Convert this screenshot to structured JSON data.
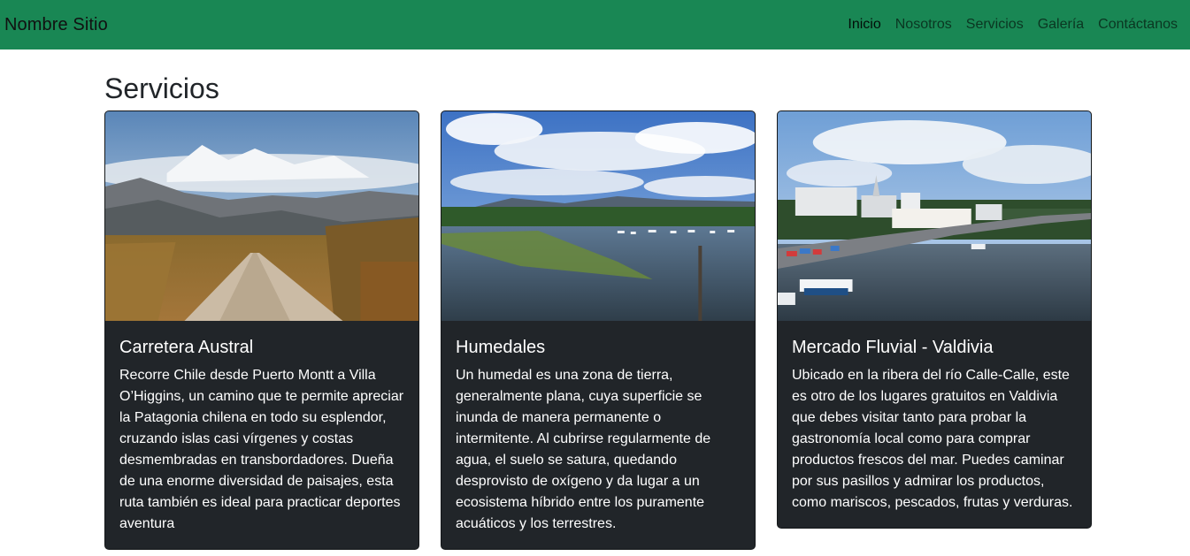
{
  "navbar": {
    "brand": "Nombre Sitio",
    "links": [
      {
        "label": "Inicio",
        "active": true
      },
      {
        "label": "Nosotros",
        "active": false
      },
      {
        "label": "Servicios",
        "active": false
      },
      {
        "label": "Galería",
        "active": false
      },
      {
        "label": "Contáctanos",
        "active": false
      }
    ]
  },
  "page": {
    "title": "Servicios"
  },
  "cards": [
    {
      "title": "Carretera Austral",
      "text": "Recorre Chile desde Puerto Montt a Villa O’Higgins, un camino que te permite apreciar la Patagonia chilena en todo su esplendor, cruzando islas casi vírgenes y costas desmembradas en transbordadores. Dueña de una enorme diversidad de paisajes, esta ruta también es ideal para practicar deportes aventura"
    },
    {
      "title": "Humedales",
      "text": "Un humedal es una zona de tierra, generalmente plana, cuya superficie se inunda de manera permanente o intermitente. Al cubrirse regularmente de agua, el suelo se satura, quedando desprovisto de oxígeno y da lugar a un ecosistema híbrido entre los puramente acuáticos y los terrestres."
    },
    {
      "title": "Mercado Fluvial - Valdivia",
      "text": "Ubicado en la ribera del río Calle-Calle, este es otro de los lugares gratuitos en Valdivia que debes visitar tanto para probar la gastronomía local como para comprar productos frescos del mar. Puedes caminar por sus pasillos y admirar los productos, como mariscos, pescados, frutas y verduras."
    }
  ],
  "colors": {
    "navbar_bg": "#198754",
    "card_bg": "#212529"
  }
}
